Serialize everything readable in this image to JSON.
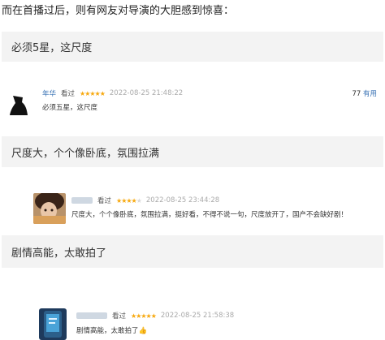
{
  "intro": "而在首播过后，则有网友对导演的大胆感到惊喜：",
  "quotes": [
    "必须5星，这尺度",
    "尺度大，个个像卧底，氛围拉满",
    "剧情高能，太敢拍了"
  ],
  "comments": [
    {
      "user": "年华",
      "status": "看过",
      "stars": "★★★★★",
      "stars_off": "",
      "time": "2022-08-25 21:48:22",
      "text": "必须五星，这尺度",
      "useful_count": "77",
      "useful_label": "有用"
    },
    {
      "user": "",
      "status": "看过",
      "stars": "★★★★",
      "stars_off": "★",
      "time": "2022-08-25 23:44:28",
      "text": "尺度大，个个像卧底，氛围拉满，挺好看，不得不说一句，尺度放开了，国产不会缺好剧！"
    },
    {
      "user": "",
      "status": "看过",
      "stars": "★★★★★",
      "stars_off": "",
      "time": "2022-08-25 21:58:38",
      "text": "剧情高能，太敢拍了👍"
    }
  ],
  "colors": {
    "quote_bg": "#f3f3f3",
    "star": "#f7a80d",
    "username": "#3a73b5"
  }
}
